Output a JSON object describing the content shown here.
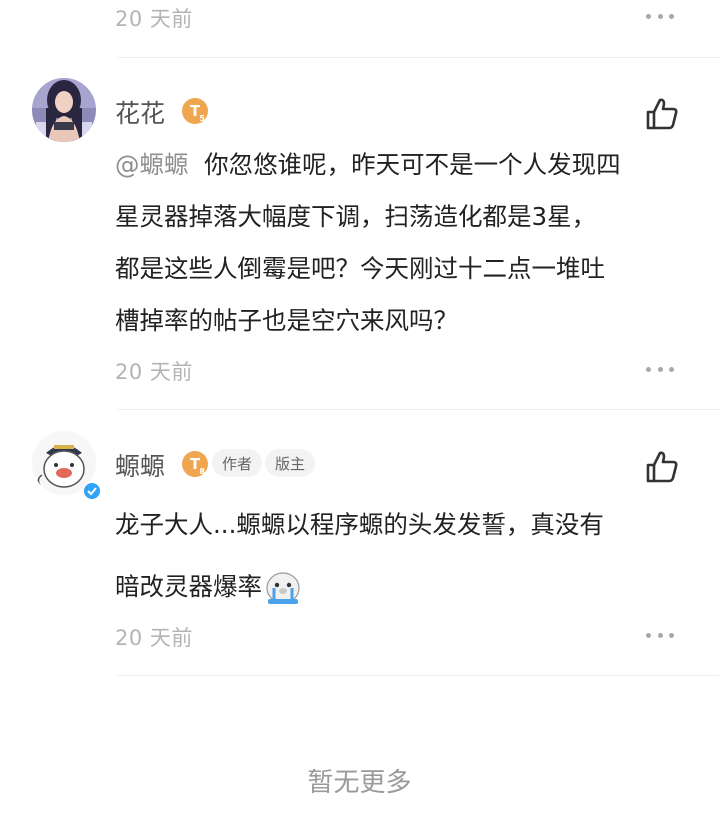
{
  "top": {
    "time": "20 天前"
  },
  "comments": [
    {
      "username": "花花",
      "level": "T",
      "level_sub": "5",
      "mention": "@螈螈",
      "lines": [
        "你忽悠谁呢，昨天可不是一个人发现四",
        "星灵器掉落大幅度下调，扫荡造化都是3星，",
        "都是这些人倒霉是吧？今天刚过十二点一堆吐",
        "槽掉率的帖子也是空穴来风吗？"
      ],
      "time": "20 天前"
    },
    {
      "username": "螈螈",
      "level": "T",
      "level_sub": "8",
      "tags": [
        "作者",
        "版主"
      ],
      "lines": [
        "龙子大人...螈螈以程序螈的头发发誓，真没有",
        "暗改灵器爆率"
      ],
      "time": "20 天前"
    }
  ],
  "footer": {
    "text": "暂无更多"
  },
  "colors": {
    "level_badge": "#f0a64e",
    "verified_badge": "#2fa3f5",
    "emoji_blue": "#4aa3ea"
  },
  "icons": {
    "like": "thumbs-up-icon",
    "more": "more-dots-icon",
    "verified": "verified-check-icon",
    "emoji": "crying-seal-emoji-icon"
  }
}
